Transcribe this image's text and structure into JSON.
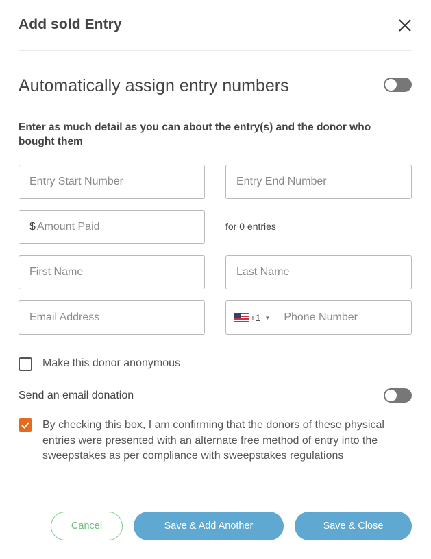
{
  "dialog": {
    "title": "Add sold Entry"
  },
  "auto_assign": {
    "label": "Automatically assign entry numbers",
    "enabled": false
  },
  "instructions": "Enter as much detail as you can about the entry(s) and the donor who bought them",
  "fields": {
    "entry_start": {
      "placeholder": "Entry Start Number",
      "value": ""
    },
    "entry_end": {
      "placeholder": "Entry End Number",
      "value": ""
    },
    "amount_paid": {
      "currency_symbol": "$",
      "placeholder": "Amount Paid",
      "value": ""
    },
    "entries_note": "for 0 entries",
    "first_name": {
      "placeholder": "First Name",
      "value": ""
    },
    "last_name": {
      "placeholder": "Last Name",
      "value": ""
    },
    "email": {
      "placeholder": "Email Address",
      "value": ""
    },
    "phone": {
      "country_code": "+1",
      "country_flag": "us-flag-icon",
      "placeholder": "Phone Number",
      "value": ""
    }
  },
  "anonymous": {
    "label": "Make this donor anonymous",
    "checked": false
  },
  "email_donation": {
    "label": "Send an email donation",
    "enabled": false
  },
  "confirmation": {
    "label": "By checking this box, I am confirming that the donors of these physical entries were presented with an alternate free method of entry into the sweepstakes as per compliance with sweepstakes regulations",
    "checked": true
  },
  "buttons": {
    "cancel": "Cancel",
    "save_add": "Save & Add Another",
    "save_close": "Save & Close"
  },
  "colors": {
    "accent_orange": "#e46a1e",
    "primary_blue": "#5ea8d2",
    "cancel_green": "#6dc079",
    "toggle_off": "#777777"
  }
}
